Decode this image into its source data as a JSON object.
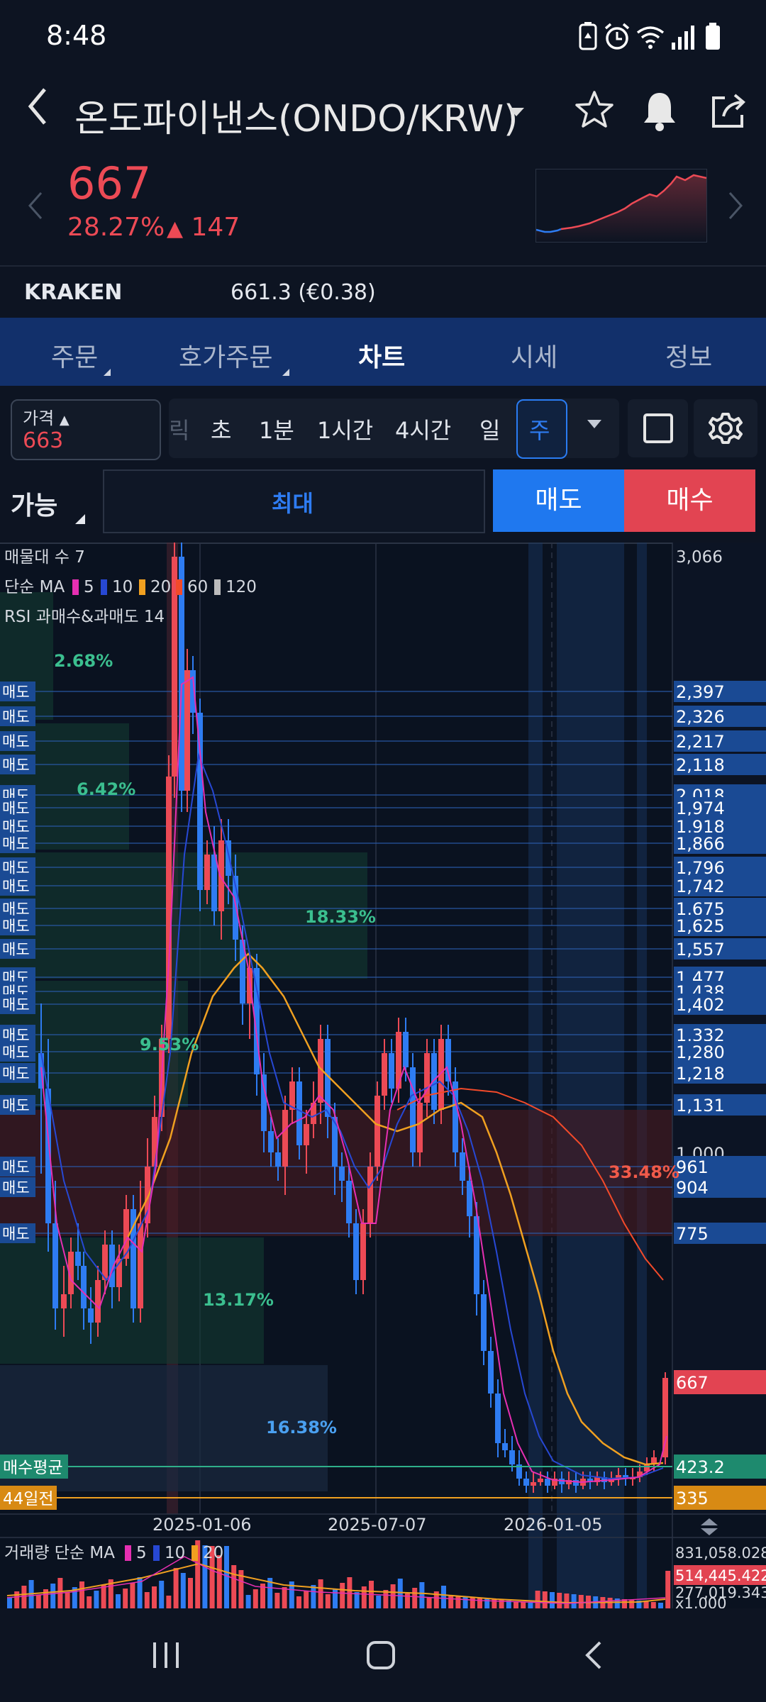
{
  "status": {
    "time": "8:48"
  },
  "header": {
    "title": "온도파이낸스(ONDO/KRW)"
  },
  "price": {
    "current": "667",
    "change_pct": "28.27%",
    "change_abs": "147"
  },
  "exchange": {
    "name": "KRAKEN",
    "value": "661.3 (€0.38)"
  },
  "tabs": [
    {
      "label": "주문"
    },
    {
      "label": "호가주문"
    },
    {
      "label": "차트"
    },
    {
      "label": "시세"
    },
    {
      "label": "정보"
    }
  ],
  "toolbar": {
    "price_label": "가격",
    "price_value": "663",
    "partial": "릭",
    "timeframes": [
      "초",
      "1분",
      "1시간",
      "4시간",
      "일",
      "주"
    ]
  },
  "order": {
    "avail_label": "가능",
    "max_label": "최대",
    "sell_label": "매도",
    "buy_label": "매수"
  },
  "chart": {
    "legend_line1": "매물대 수 7",
    "legend_ma_prefix": "단순 MA",
    "ma_periods": [
      "5",
      "10",
      "20",
      "60",
      "120"
    ],
    "ma_colors": [
      "#e62fb2",
      "#2748d4",
      "#f0a020",
      "#f24a2a",
      "#bcbcbc"
    ],
    "legend_line3": "RSI 과매수&과매도 14",
    "top_axis_value": "3,066",
    "sell_tag": "매도",
    "price_levels": [
      {
        "label": "2,397",
        "tagged": true
      },
      {
        "label": "2,326",
        "tagged": true
      },
      {
        "label": "2,217",
        "tagged": true
      },
      {
        "label": "2,118",
        "tagged": true
      },
      {
        "label": "2,018",
        "tagged": true
      },
      {
        "label": "1,974",
        "tagged": true
      },
      {
        "label": "1,918",
        "tagged": true
      },
      {
        "label": "1,866",
        "tagged": true
      },
      {
        "label": "1,796",
        "tagged": true
      },
      {
        "label": "1,742",
        "tagged": true
      },
      {
        "label": "1,675",
        "tagged": true
      },
      {
        "label": "1,625",
        "tagged": true
      },
      {
        "label": "1,557",
        "tagged": true
      },
      {
        "label": "1,477",
        "tagged": true
      },
      {
        "label": "1,438",
        "tagged": true
      },
      {
        "label": "1,402",
        "tagged": true
      },
      {
        "label": "1,332",
        "tagged": true
      },
      {
        "label": "1,280",
        "tagged": true
      },
      {
        "label": "1,218",
        "tagged": true
      },
      {
        "label": "1,131",
        "tagged": true
      },
      {
        "label": "1,000",
        "tagged": false
      },
      {
        "label": "961",
        "tagged": true
      },
      {
        "label": "904",
        "tagged": true
      },
      {
        "label": "775",
        "tagged": true
      }
    ],
    "current_price_tag": "667",
    "avg_buy": {
      "label": "매수평균",
      "value": "423.2"
    },
    "days44": {
      "label": "44일전",
      "value": "335"
    },
    "volume_profile": [
      "2.68%",
      "6.42%",
      "18.33%",
      "9.53%",
      "33.48%",
      "13.17%",
      "16.38%"
    ],
    "dates": [
      "2025-01-06",
      "2025-07-07",
      "2026-01-05"
    ],
    "volume_legend_prefix": "거래량 단순 MA",
    "volume_ma": [
      "5",
      "10",
      "20"
    ],
    "volume_values": [
      "831,058.028",
      "514,445.422",
      "277,019.343",
      "x1,000"
    ]
  },
  "colors": {
    "up": "#ec4a55",
    "down": "#2e7cf2",
    "tab_bg": "#12306b",
    "bg": "#0d1422"
  }
}
